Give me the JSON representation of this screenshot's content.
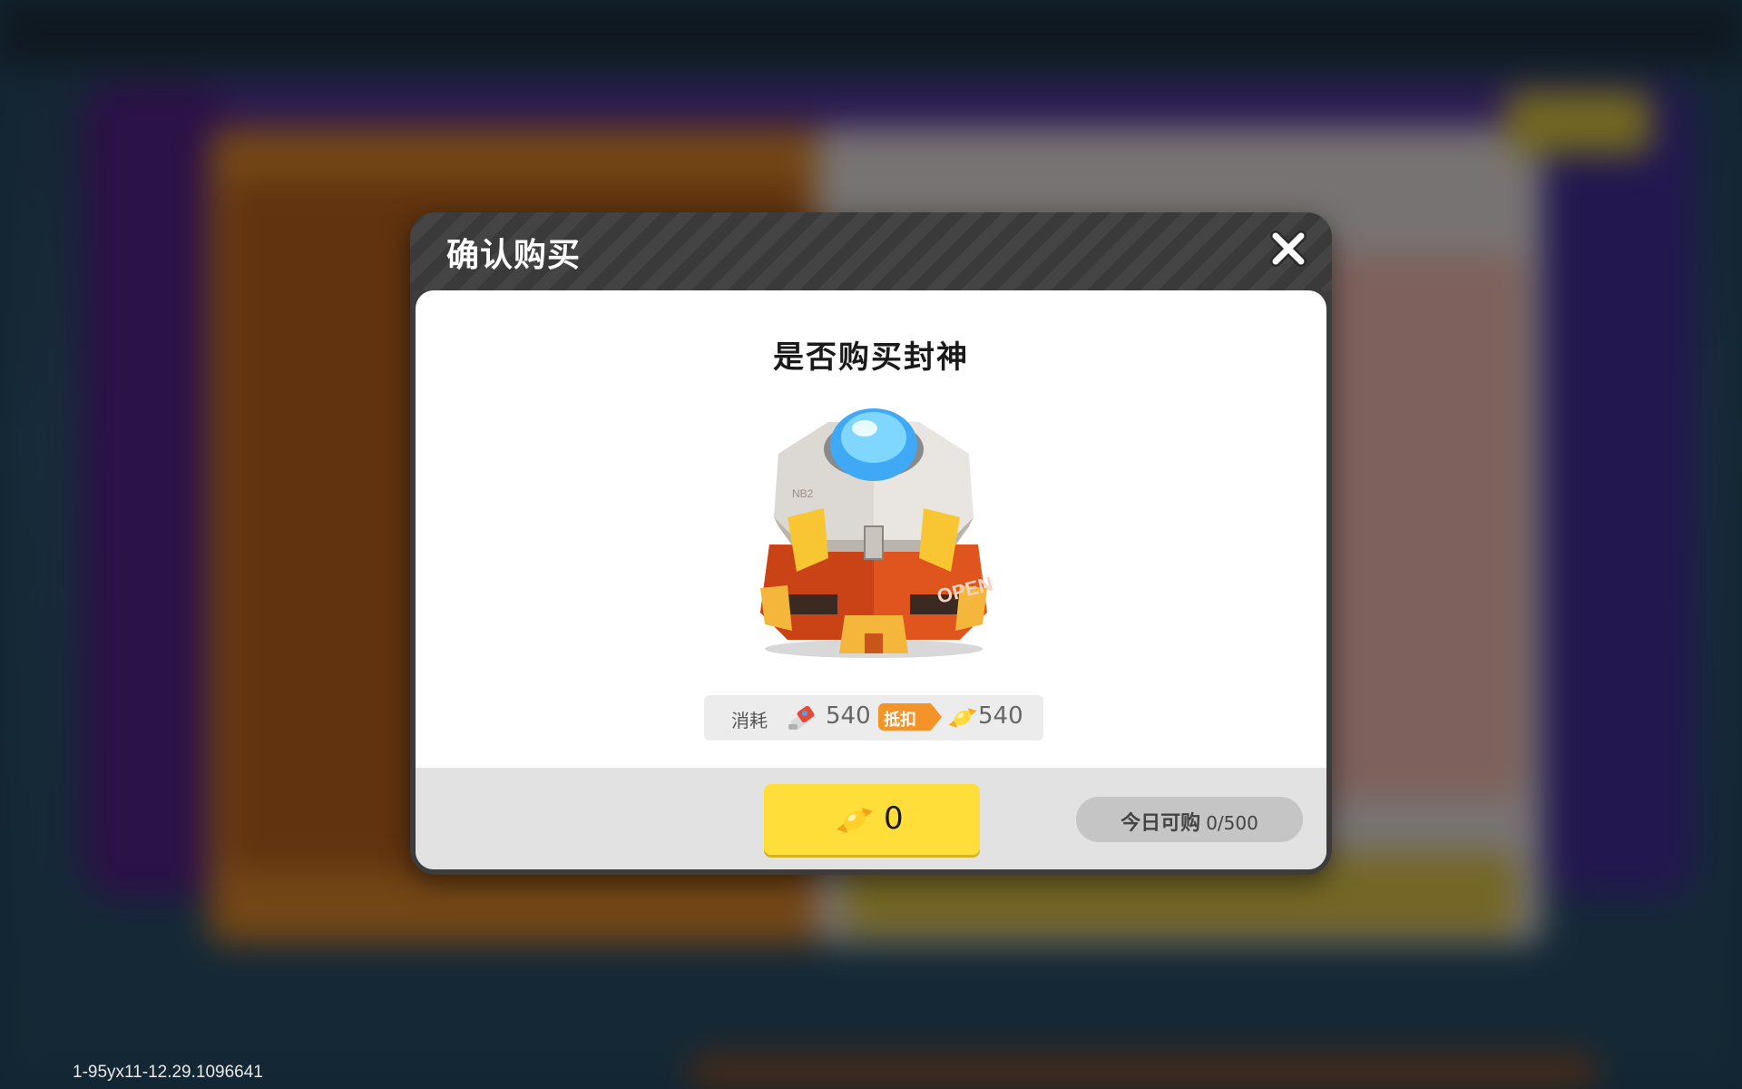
{
  "dialog": {
    "title": "确认购买",
    "question": "是否购买封神",
    "item_icon": "crate-icon",
    "close_icon": "close-icon"
  },
  "cost": {
    "label": "消耗",
    "ticket_icon": "ticket-icon",
    "ticket_amount": "540",
    "deduct_label": "抵扣",
    "candy_icon": "candy-icon",
    "candy_amount": "540"
  },
  "purchase": {
    "price": "0",
    "currency_icon": "candy-icon"
  },
  "daily_limit": {
    "label": "今日可购",
    "value": "0/500"
  },
  "build_id": "1-95yx11-12.29.1096641",
  "colors": {
    "buy_button": "#ffde3a",
    "deduct_tag": "#f49327",
    "header": "#3c3c3c"
  }
}
